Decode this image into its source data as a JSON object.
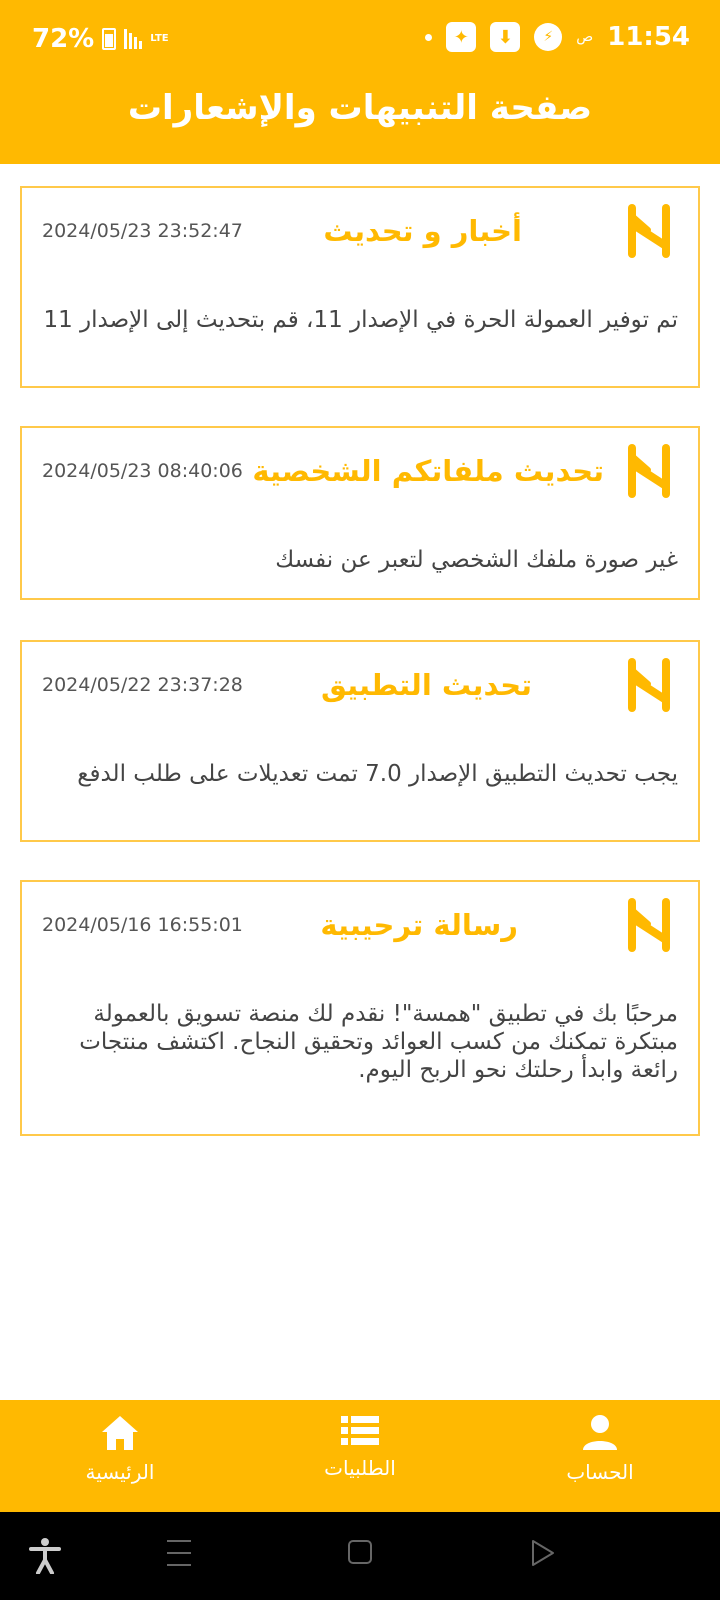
{
  "status_bar": {
    "battery": "72%",
    "network": "LTE",
    "ampm": "ص",
    "time": "11:54"
  },
  "header": {
    "title": "صفحة التنبيهات والإشعارات"
  },
  "notifications": [
    {
      "title": "أخبار و تحديث",
      "timestamp": "2024/05/23 23:52:47",
      "body": "تم توفير العمولة الحرة في الإصدار 11، قم بتحديث إلى الإصدار 11"
    },
    {
      "title": "تحديث ملفاتكم الشخصية",
      "timestamp": "2024/05/23 08:40:06",
      "body": "غير صورة ملفك الشخصي لتعبر عن نفسك"
    },
    {
      "title": "تحديث التطبيق",
      "timestamp": "2024/05/22 23:37:28",
      "body": "يجب تحديث التطبيق الإصدار 7.0 تمت تعديلات على طلب الدفع"
    },
    {
      "title": "رسالة ترحيبية",
      "timestamp": "2024/05/16 16:55:01",
      "body": "مرحبًا بك في تطبيق \"همسة\"! نقدم لك منصة تسويق بالعمولة مبتكرة تمكنك من كسب العوائد وتحقيق النجاح. اكتشف منتجات رائعة وابدأ رحلتك نحو الربح اليوم."
    }
  ],
  "bottom_nav": {
    "home": "الرئيسية",
    "orders": "الطلبيات",
    "account": "الحساب"
  },
  "colors": {
    "accent": "#FFB901",
    "card_border": "#FFC94A"
  }
}
